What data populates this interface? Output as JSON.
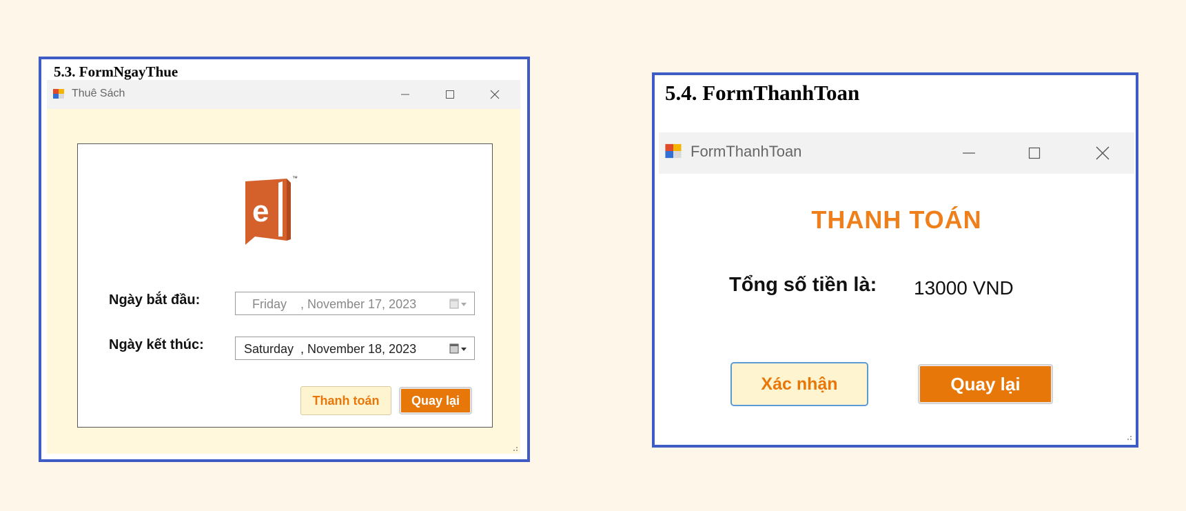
{
  "left": {
    "caption": "5.3. FormNgayThue",
    "window_title": "Thuê Sách",
    "start_label": "Ngày bắt đầu:",
    "end_label": "Ngày kết thúc:",
    "start_date": {
      "day": "Friday",
      "rest": ", November 17, 2023"
    },
    "end_date": {
      "day": "Saturday",
      "rest": ", November 18, 2023"
    },
    "pay_button": "Thanh toán",
    "back_button": "Quay lại",
    "logo_tm": "™"
  },
  "right": {
    "caption": "5.4. FormThanhToan",
    "window_title": "FormThanhToan",
    "heading": "THANH TOÁN",
    "total_label": "Tổng số tiền là:",
    "total_value": "13000 VND",
    "confirm_button": "Xác nhận",
    "back_button": "Quay lại"
  },
  "colors": {
    "accent_orange": "#e8770a",
    "panel_border": "#3f5bc4",
    "form_background": "#fff8dc"
  }
}
